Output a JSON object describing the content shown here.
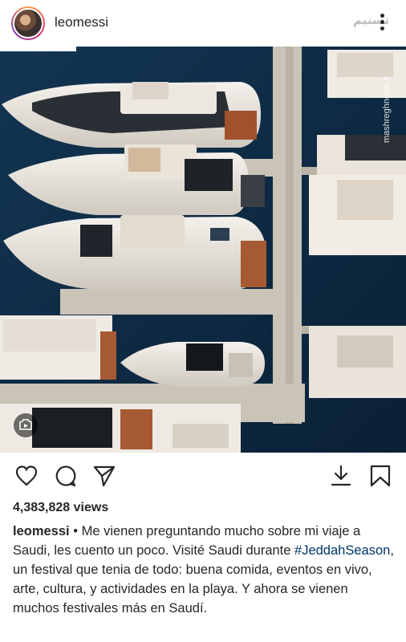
{
  "header": {
    "username": "leomessi",
    "watermark_text": "تسنیم",
    "more_icon": "more-vertical-icon"
  },
  "media": {
    "description_icon": "video-icon",
    "side_watermark": "mashreghnews.ir"
  },
  "actions": {
    "like_icon": "heart-icon",
    "comment_icon": "comment-icon",
    "share_icon": "share-icon",
    "download_icon": "download-icon",
    "save_icon": "bookmark-icon"
  },
  "post": {
    "views": "4,383,828 views",
    "caption_user": "leomessi",
    "caption_separator": " • ",
    "caption_part1": "Me vienen preguntando mucho sobre mi viaje a Saudi, les cuento un poco. Visité Saudi durante ",
    "caption_hashtag": "#JeddahSeason",
    "caption_part2": ", un festival que tenia de todo: buena comida, eventos en vivo, arte, cultura, y actividades en la playa. Y ahora se vienen muchos festivales más en Saudí."
  },
  "colors": {
    "water": "#0f2a44",
    "dock": "#c9c3b8",
    "hashtag": "#003569",
    "text": "#262626"
  }
}
